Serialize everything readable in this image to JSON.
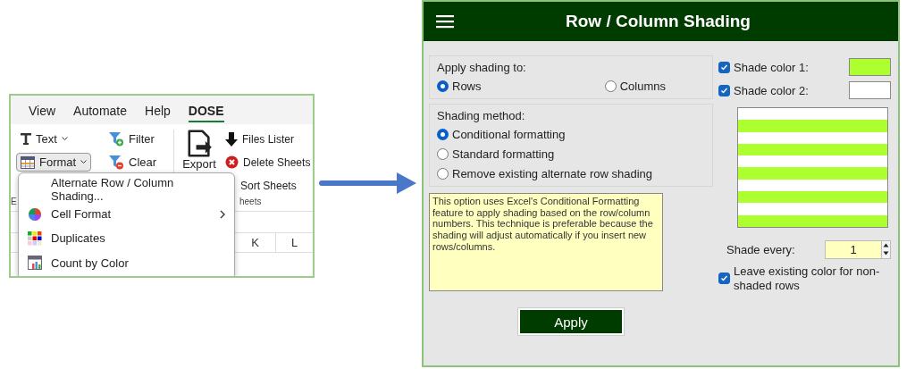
{
  "excel": {
    "tabs": [
      {
        "label": "View",
        "selected": false
      },
      {
        "label": "Automate",
        "selected": false
      },
      {
        "label": "Help",
        "selected": false
      },
      {
        "label": "DOSE",
        "selected": true
      }
    ],
    "ribbon": {
      "text_button": {
        "label": "Text",
        "pressed": false
      },
      "format_button": {
        "label": "Format",
        "pressed": true
      },
      "filter_buttons": [
        "Filter",
        "Clear"
      ],
      "export_button": "Export",
      "sheet_buttons": [
        "Files Lister",
        "Delete Sheets",
        "Sort Sheets"
      ],
      "group_labels": [
        "E",
        "heets"
      ]
    },
    "column_headers": [
      "K",
      "L"
    ],
    "menu": [
      {
        "label": "Alternate Row / Column Shading...",
        "kind": "plain",
        "submenu": false
      },
      {
        "label": "Cell Format",
        "kind": "wheel",
        "submenu": true
      },
      {
        "label": "Duplicates",
        "kind": "grid",
        "submenu": false
      },
      {
        "label": "Count by Color",
        "kind": "table",
        "submenu": false
      }
    ]
  },
  "dialog": {
    "title": "Row / Column Shading",
    "apply_to": {
      "label": "Apply shading to:",
      "options": [
        {
          "label": "Rows",
          "selected": true
        },
        {
          "label": "Columns",
          "selected": false
        }
      ]
    },
    "method": {
      "label": "Shading method:",
      "options": [
        {
          "label": "Conditional formatting",
          "selected": true
        },
        {
          "label": "Standard formatting",
          "selected": false
        },
        {
          "label": "Remove existing alternate row shading",
          "selected": false
        }
      ]
    },
    "description": "This option uses Excel's Conditional Formatting feature to apply shading based on the row/column numbers. This technique is preferable because the shading will adjust automatically if you insert new rows/columns.",
    "shade_colors": [
      {
        "label": "Shade color 1:",
        "checked": true,
        "color": "#adff2f"
      },
      {
        "label": "Shade color 2:",
        "checked": true,
        "color": "#ffffff"
      }
    ],
    "shade_every": {
      "label": "Shade every:",
      "value": "1"
    },
    "leave_existing": {
      "label": "Leave existing color for non-shaded rows",
      "checked": true
    },
    "apply_button": "Apply"
  }
}
